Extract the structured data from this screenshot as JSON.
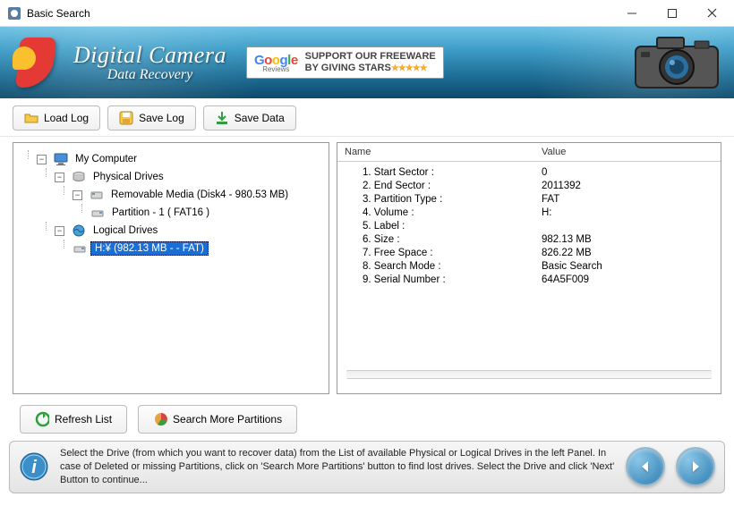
{
  "window": {
    "title": "Basic Search"
  },
  "banner": {
    "title": "Digital Camera",
    "subtitle": "Data Recovery",
    "review_line1": "SUPPORT OUR FREEWARE",
    "review_line2": "BY GIVING STARS",
    "reviews_label": "Reviews"
  },
  "toolbar": {
    "load_log": "Load Log",
    "save_log": "Save Log",
    "save_data": "Save Data"
  },
  "tree": {
    "root": "My Computer",
    "physical": "Physical Drives",
    "removable": "Removable Media (Disk4 - 980.53 MB)",
    "partition": "Partition - 1 ( FAT16 )",
    "logical": "Logical Drives",
    "selected": "H:¥ (982.13 MB -  - FAT)"
  },
  "details": {
    "head_name": "Name",
    "head_value": "Value",
    "rows": [
      {
        "name": "1. Start Sector :",
        "value": "0"
      },
      {
        "name": "2. End Sector :",
        "value": "2011392"
      },
      {
        "name": "3. Partition Type :",
        "value": "FAT"
      },
      {
        "name": "4. Volume :",
        "value": "H:"
      },
      {
        "name": "5. Label :",
        "value": ""
      },
      {
        "name": "6. Size :",
        "value": "982.13 MB"
      },
      {
        "name": "7. Free Space :",
        "value": "826.22 MB"
      },
      {
        "name": "8. Search Mode :",
        "value": "Basic Search"
      },
      {
        "name": "9. Serial Number :",
        "value": "64A5F009"
      }
    ]
  },
  "bottom": {
    "refresh": "Refresh List",
    "search_more": "Search More Partitions"
  },
  "footer": {
    "text": "Select the Drive (from which you want to recover data) from the List of available Physical or Logical Drives in the left Panel. In case of Deleted or missing Partitions, click on 'Search More Partitions' button to find lost drives. Select the Drive and click 'Next' Button to continue..."
  }
}
